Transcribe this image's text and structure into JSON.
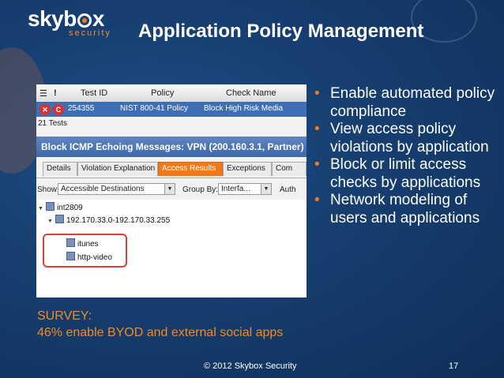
{
  "logo": {
    "prefix": "skyb",
    "suffix": "x",
    "subtitle": "security"
  },
  "slide": {
    "title": "Application Policy Management",
    "footer": "© 2012 Skybox Security",
    "page": "17"
  },
  "app": {
    "grid_header": {
      "icon1": "☰",
      "icon2": "!",
      "test_id": "Test ID",
      "policy": "Policy",
      "check_name": "Check Name"
    },
    "grid_row": {
      "status1": "✕",
      "status2": "C",
      "test_id": "254355",
      "policy": "NIST 800-41 Policy",
      "check_name": "Block High Risk Media"
    },
    "tests_count": "21 Tests",
    "block_title": "Block ICMP Echoing Messages: VPN (200.160.3.1, Partner) -",
    "tabs": [
      "Details",
      "Violation Explanation",
      "Access Results",
      "Exceptions",
      "Com"
    ],
    "active_tab": "Access Results",
    "filter": {
      "show_label": "Show:",
      "show_value": "Accessible Destinations",
      "group_label": "Group By:",
      "group_value": "Interfa...",
      "auth_label": "Auth"
    },
    "tree": {
      "root": "int2809",
      "range": "192.170.33.0-192.170.33.255",
      "app1": "itunes",
      "app2": "http-video"
    }
  },
  "bullets": [
    "Enable automated policy compliance",
    "View access policy violations by application",
    "Block or limit access checks by applications",
    "Network modeling of users and applications"
  ],
  "survey": {
    "line1": "SURVEY:",
    "line2": "46% enable BYOD and external social apps"
  },
  "colors": {
    "accent": "#f07a1a",
    "background": "#163e6f",
    "highlight": "#e03c3c"
  }
}
